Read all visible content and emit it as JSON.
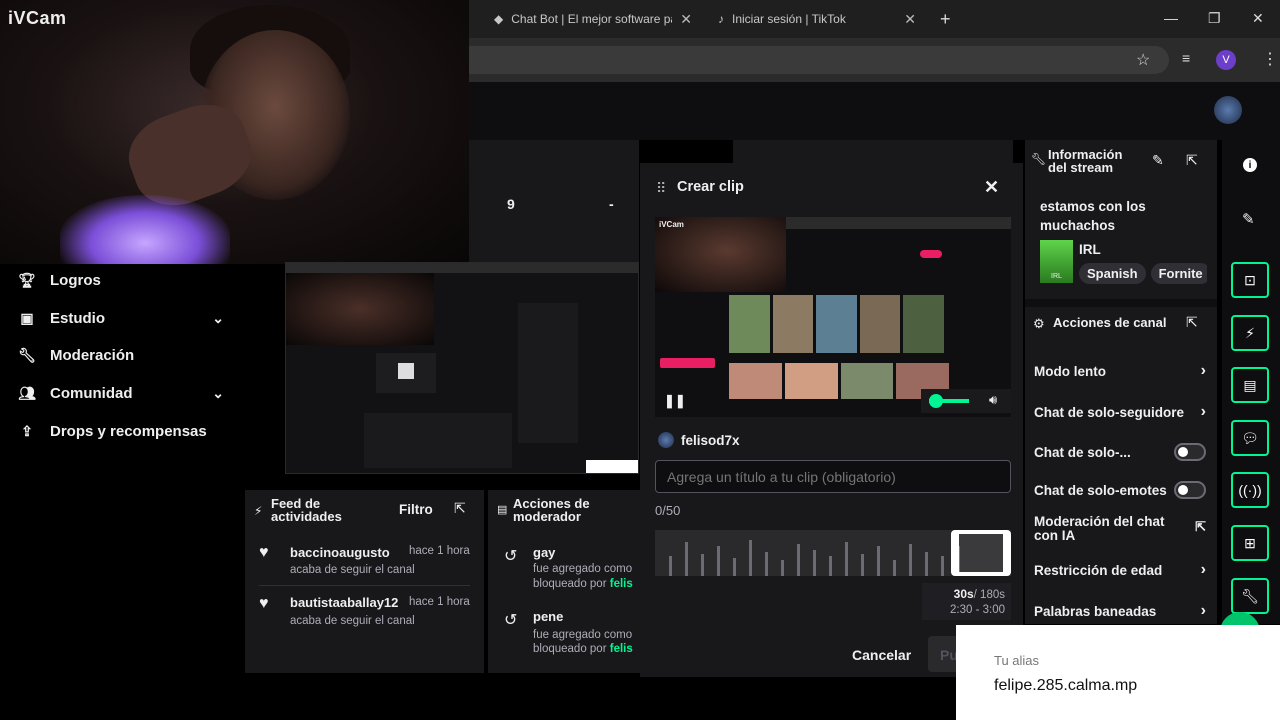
{
  "webcam": {
    "brand": "iVCam"
  },
  "browser": {
    "tabs": [
      {
        "title": "Chat Bot | El mejor software pa",
        "icon": "chatbot-icon"
      },
      {
        "title": "Iniciar sesión | TikTok",
        "icon": "tiktok-icon"
      }
    ],
    "profile_initial": "V"
  },
  "sidebar": {
    "items": [
      {
        "label": "Logros",
        "icon": "trophy-icon",
        "expandable": false
      },
      {
        "label": "Estudio",
        "icon": "studio-icon",
        "expandable": true
      },
      {
        "label": "Moderación",
        "icon": "wrench-icon",
        "expandable": false
      },
      {
        "label": "Comunidad",
        "icon": "community-icon",
        "expandable": true
      },
      {
        "label": "Drops y recompensas",
        "icon": "drops-icon",
        "expandable": false
      }
    ]
  },
  "stats": {
    "left_value": "9",
    "right_value": "-"
  },
  "activity_feed": {
    "title_line1": "Feed de",
    "title_line2": "actividades",
    "filter_label": "Filtro",
    "items": [
      {
        "user": "baccinoaugusto",
        "time": "hace 1 hora",
        "action": "acaba de seguir el canal"
      },
      {
        "user": "bautistaaballay12",
        "time": "hace 1 hora",
        "action": "acaba de seguir el canal"
      }
    ]
  },
  "mod_actions": {
    "title_line1": "Acciones de",
    "title_line2": "moderador",
    "items": [
      {
        "term": "gay",
        "line1": "fue agregado como",
        "line2": "bloqueado por",
        "by": "felis"
      },
      {
        "term": "pene",
        "line1": "fue agregado como",
        "line2": "bloqueado por",
        "by": "felis"
      }
    ]
  },
  "clip_modal": {
    "title": "Crear clip",
    "preview_label": "iVCam",
    "streamer": "felisod7x",
    "title_placeholder": "Agrega un título a tu clip (obligatorio)",
    "char_count": "0/50",
    "duration": "30s",
    "duration_max": "/ 180s",
    "range": "2:30 - 3:00",
    "cancel_label": "Cancelar",
    "publish_label": "Pu"
  },
  "stream_info": {
    "title_line1": "Información",
    "title_line2": "del stream",
    "stream_title_line1": "estamos con los",
    "stream_title_line2": "muchachos",
    "category": "IRL",
    "category_thumb_label": "IRL",
    "tags": [
      "Spanish",
      "Fornite"
    ]
  },
  "channel_actions": {
    "title": "Acciones de canal",
    "items": [
      {
        "label": "Modo lento",
        "control": "chevron"
      },
      {
        "label": "Chat de solo-seguidore",
        "control": "chevron"
      },
      {
        "label": "Chat de solo-...",
        "control": "toggle"
      },
      {
        "label": "Chat de solo-emotes",
        "control": "toggle"
      },
      {
        "label_line1": "Moderación del chat",
        "label_line2": "con IA",
        "control": "external"
      },
      {
        "label": "Restricción de edad",
        "control": "chevron"
      },
      {
        "label": "Palabras baneadas",
        "control": "chevron"
      }
    ]
  },
  "alias_card": {
    "label": "Tu alias",
    "value": "felipe.285.calma.mp"
  },
  "colors": {
    "accent_green": "#00f593",
    "panel": "#18181b",
    "bg": "#0e0e10"
  }
}
